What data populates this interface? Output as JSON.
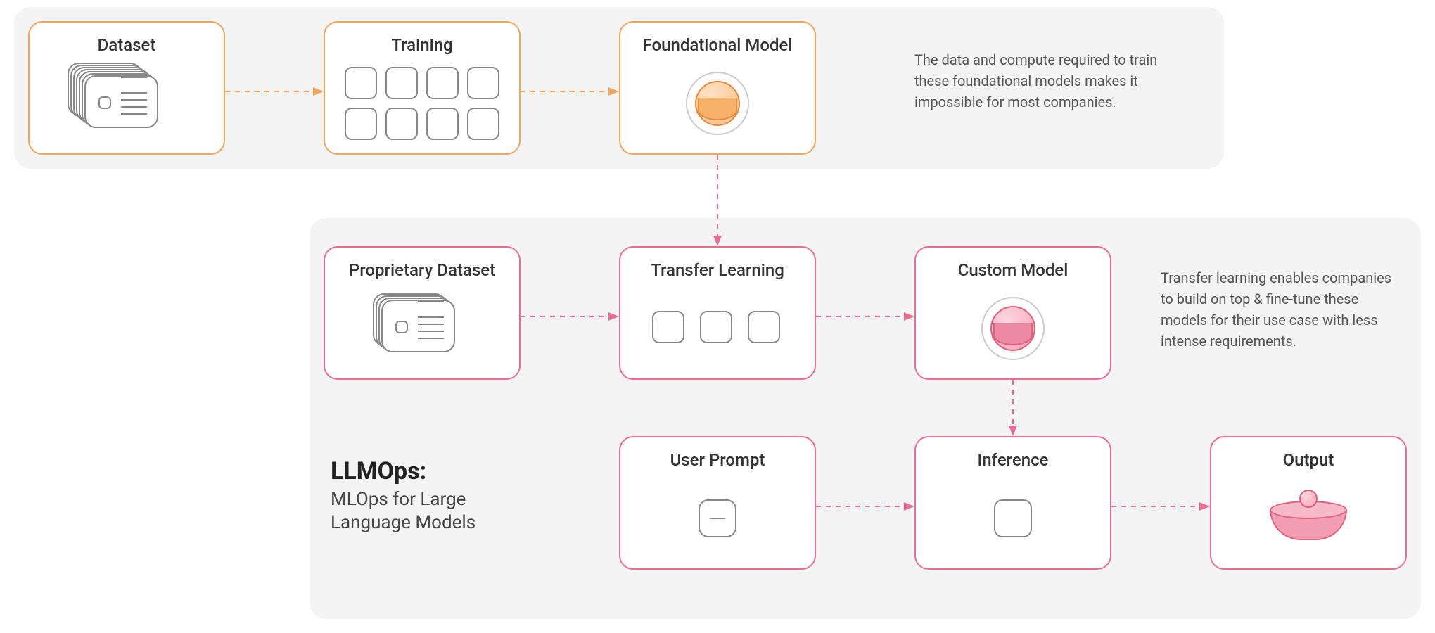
{
  "top_row": {
    "cards": {
      "dataset": "Dataset",
      "training": "Training",
      "foundational_model": "Foundational Model"
    },
    "caption": "The data and compute required to train these foundational models makes it impossible for most companies."
  },
  "mid_row": {
    "cards": {
      "proprietary_dataset": "Proprietary Dataset",
      "transfer_learning": "Transfer Learning",
      "custom_model": "Custom Model"
    },
    "caption": "Transfer learning enables companies to build on top & fine-tune these models for their use case with less intense requirements."
  },
  "bottom_row": {
    "cards": {
      "user_prompt": "User Prompt",
      "inference": "Inference",
      "output": "Output"
    }
  },
  "title": {
    "heading": "LLMOps:",
    "sub": "MLOps for Large Language Models"
  },
  "colors": {
    "orange": "#f5a45a",
    "pink": "#ec6d8f",
    "panel_bg": "#f4f4f4"
  }
}
